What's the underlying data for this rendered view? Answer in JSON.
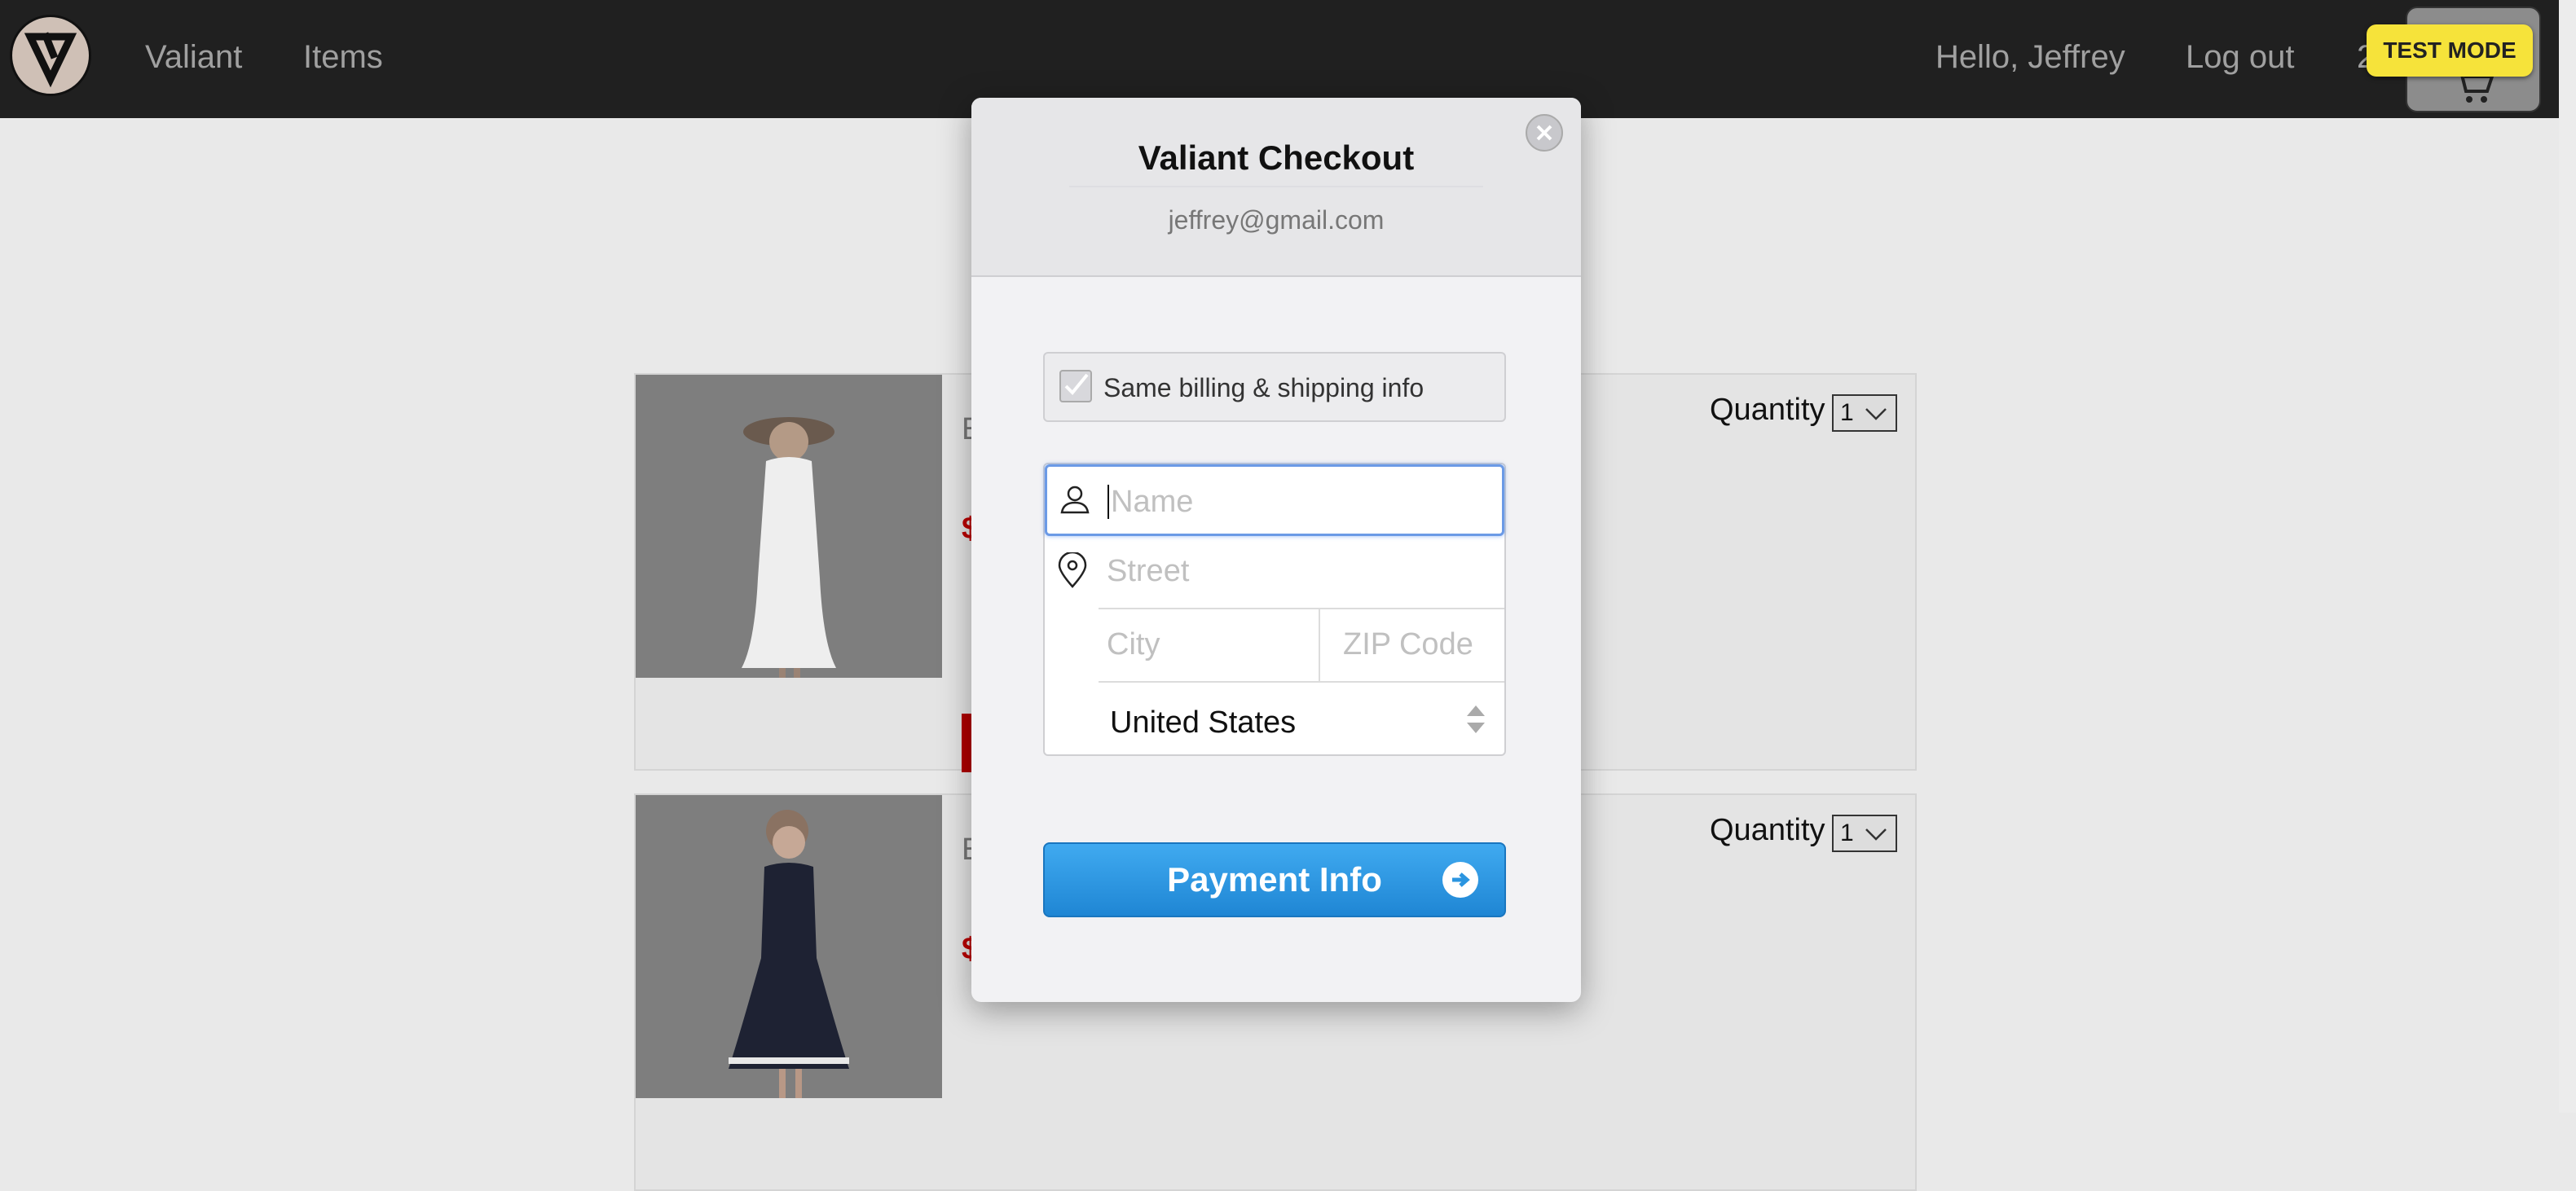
{
  "nav": {
    "brand": "Valiant",
    "items_link": "Items",
    "greeting": "Hello, Jeffrey",
    "logout": "Log out",
    "cart_count": "2",
    "test_mode": "TEST MODE"
  },
  "products": [
    {
      "name": "E",
      "price": "$",
      "quantity_label": "Quantity",
      "quantity_value": "1"
    },
    {
      "name": "E",
      "price": "$",
      "quantity_label": "Quantity",
      "quantity_value": "1"
    }
  ],
  "checkout": {
    "title": "Valiant Checkout",
    "email": "jeffrey@gmail.com",
    "same_info_label": "Same billing & shipping info",
    "same_info_checked": true,
    "name_placeholder": "Name",
    "street_placeholder": "Street",
    "city_placeholder": "City",
    "zip_placeholder": "ZIP Code",
    "country": "United States",
    "submit_label": "Payment Info"
  },
  "colors": {
    "topbar": "#202020",
    "accent_blue": "#2b95e0",
    "test_mode": "#f6e33a",
    "price_red": "#b00000"
  }
}
